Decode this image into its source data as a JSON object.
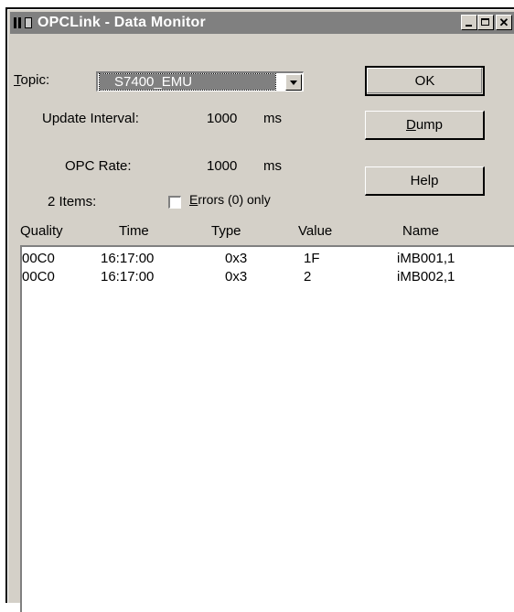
{
  "window": {
    "title": "OPCLink - Data Monitor",
    "controls": {
      "minimize": "_",
      "maximize": "□",
      "close": "✕"
    }
  },
  "topic": {
    "label": "Topic:",
    "value": "S7400_EMU"
  },
  "update_interval": {
    "label": "Update Interval:",
    "value": "1000",
    "unit": "ms"
  },
  "opc_rate": {
    "label": "OPC Rate:",
    "value": "1000",
    "unit": "ms"
  },
  "items": {
    "count_label": "2 Items:"
  },
  "errors_only": {
    "label": "Errors (0) only",
    "checked": false
  },
  "buttons": {
    "ok": "OK",
    "dump": "Dump",
    "help": "Help"
  },
  "columns": [
    "Quality",
    "Time",
    "Type",
    "Value",
    "Name"
  ],
  "rows": [
    {
      "quality": "00C0",
      "time": "16:17:00",
      "type": "0x3",
      "value": "1F",
      "name": "iMB001,1"
    },
    {
      "quality": "00C0",
      "time": "16:17:00",
      "type": "0x3",
      "value": "2",
      "name": "iMB002,1"
    }
  ]
}
